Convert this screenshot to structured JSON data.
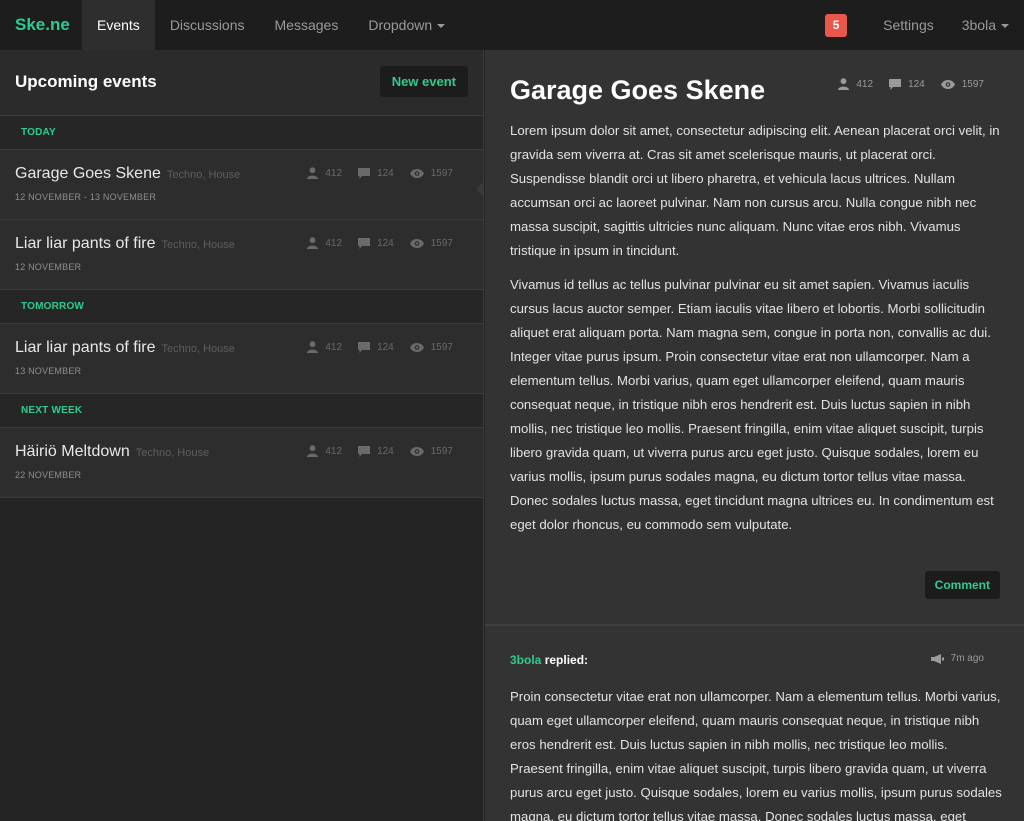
{
  "nav": {
    "brand": "Ske.ne",
    "items": [
      {
        "label": "Events",
        "active": true
      },
      {
        "label": "Discussions",
        "active": false
      },
      {
        "label": "Messages",
        "active": false
      },
      {
        "label": "Dropdown",
        "active": false
      }
    ],
    "notification_count": "5",
    "settings": "Settings",
    "user": "3bola"
  },
  "events_panel": {
    "title": "Upcoming events",
    "new_event_button": "New event",
    "groups": [
      {
        "label": "TODAY",
        "events": [
          {
            "name": "Garage Goes Skene",
            "genre": "Techno, House",
            "date": "12 NOVEMBER - 13 NOVEMBER",
            "attendees": "412",
            "comments": "124",
            "views": "1597",
            "selected": true
          }
        ]
      },
      {
        "label": "",
        "events": [
          {
            "name": "Liar liar pants of fire",
            "genre": "Techno, House",
            "date": "12 NOVEMBER",
            "attendees": "412",
            "comments": "124",
            "views": "1597"
          }
        ]
      },
      {
        "label": "TOMORROW",
        "events": [
          {
            "name": "Liar liar pants of fire",
            "genre": "Techno, House",
            "date": "13 NOVEMBER",
            "attendees": "412",
            "comments": "124",
            "views": "1597"
          }
        ]
      },
      {
        "label": "NEXT WEEK",
        "events": [
          {
            "name": "Häiriö Meltdown",
            "genre": "Techno, House",
            "date": "22 NOVEMBER",
            "attendees": "412",
            "comments": "124",
            "views": "1597"
          }
        ]
      }
    ]
  },
  "detail": {
    "title": "Garage Goes Skene",
    "attendees": "412",
    "comments": "124",
    "views": "1597",
    "paragraphs": [
      "Lorem ipsum dolor sit amet, consectetur adipiscing elit. Aenean placerat orci velit, in gravida sem viverra at. Cras sit amet scelerisque mauris, ut placerat orci. Suspendisse blandit orci ut libero pharetra, et vehicula lacus ultrices. Nullam accumsan orci ac laoreet pulvinar. Nam non cursus arcu. Nulla congue nibh nec massa suscipit, sagittis ultricies nunc aliquam. Nunc vitae eros nibh. Vivamus tristique in ipsum in tincidunt.",
      "Vivamus id tellus ac tellus pulvinar pulvinar eu sit amet sapien. Vivamus iaculis cursus lacus auctor semper. Etiam iaculis vitae libero et lobortis. Morbi sollicitudin aliquet erat aliquam porta. Nam magna sem, congue in porta non, convallis ac dui. Integer vitae purus ipsum. Proin consectetur vitae erat non ullamcorper. Nam a elementum tellus. Morbi varius, quam eget ullamcorper eleifend, quam mauris consequat neque, in tristique nibh eros hendrerit est. Duis luctus sapien in nibh mollis, nec tristique leo mollis. Praesent fringilla, enim vitae aliquet suscipit, turpis libero gravida quam, ut viverra purus arcu eget justo. Quisque sodales, lorem eu varius mollis, ipsum purus sodales magna, eu dictum tortor tellus vitae massa. Donec sodales luctus massa, eget tincidunt magna ultrices eu. In condimentum est eget dolor rhoncus, eu commodo sem vulputate."
    ],
    "comment_button": "Comment",
    "reply": {
      "author": "3bola",
      "action": "replied:",
      "time": "7m ago",
      "body": "Proin consectetur vitae erat non ullamcorper. Nam a elementum tellus. Morbi varius, quam eget ullamcorper eleifend, quam mauris consequat neque, in tristique nibh eros hendrerit est. Duis luctus sapien in nibh mollis, nec tristique leo mollis. Praesent fringilla, enim vitae aliquet suscipit, turpis libero gravida quam, ut viverra purus arcu eget justo. Quisque sodales, lorem eu varius mollis, ipsum purus sodales magna, eu dictum tortor tellus vitae massa. Donec sodales luctus massa, eget tincidunt magna ultrices eu."
    }
  },
  "icons": {
    "attendees": "user-icon",
    "comments": "comment-icon",
    "views": "eye-icon",
    "reply_time": "megaphone-icon"
  },
  "colors": {
    "accent": "#2ecc8f",
    "badge": "#e9574b",
    "nav_bg": "#1d1d1d",
    "panel_bg": "#2d2d2d",
    "detail_bg": "#333333"
  }
}
